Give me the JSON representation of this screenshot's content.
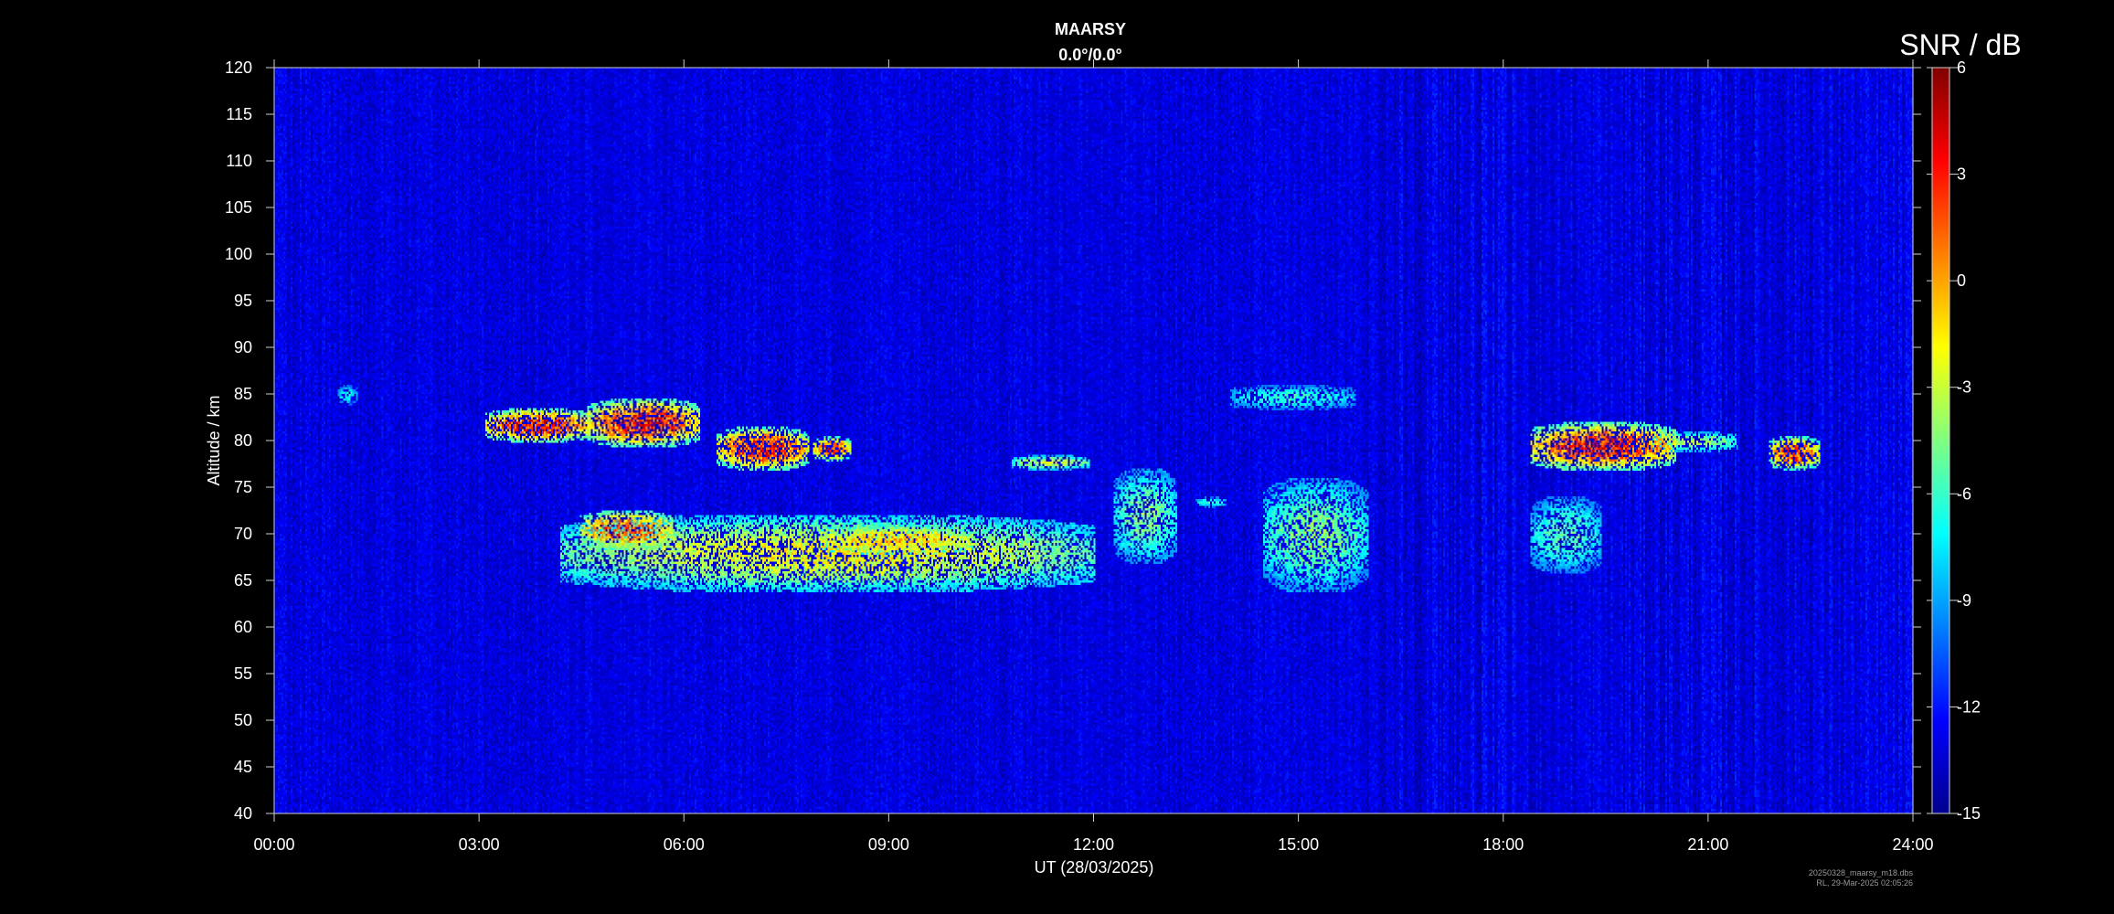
{
  "chart_data": {
    "type": "heatmap",
    "title": "MAARSY",
    "subtitle": "0.0°/0.0°",
    "xlabel": "UT (28/03/2025)",
    "ylabel": "Altitude / km",
    "xlim": [
      0,
      24
    ],
    "ylim": [
      40,
      120
    ],
    "x_ticks": [
      "00:00",
      "03:00",
      "06:00",
      "09:00",
      "12:00",
      "15:00",
      "18:00",
      "21:00",
      "24:00"
    ],
    "x_tick_values": [
      0,
      3,
      6,
      9,
      12,
      15,
      18,
      21,
      24
    ],
    "y_ticks": [
      40,
      45,
      50,
      55,
      60,
      65,
      70,
      75,
      80,
      85,
      90,
      95,
      100,
      105,
      110,
      115,
      120
    ],
    "colorbar": {
      "label": "SNR / dB",
      "range": [
        -15,
        6
      ],
      "ticks": [
        6,
        3,
        0,
        -3,
        -6,
        -9,
        -12,
        -15
      ],
      "colormap": "jet"
    },
    "background_snr": -13,
    "echo_regions": [
      {
        "t_start": 3.1,
        "t_end": 4.6,
        "alt_low": 80,
        "alt_high": 83.5,
        "peak_snr": 6
      },
      {
        "t_start": 4.6,
        "t_end": 6.2,
        "alt_low": 79.5,
        "alt_high": 84.5,
        "peak_snr": 6
      },
      {
        "t_start": 6.5,
        "t_end": 7.8,
        "alt_low": 77,
        "alt_high": 81.5,
        "peak_snr": 6
      },
      {
        "t_start": 7.9,
        "t_end": 8.4,
        "alt_low": 78,
        "alt_high": 80.5,
        "peak_snr": 5
      },
      {
        "t_start": 4.5,
        "t_end": 5.8,
        "alt_low": 68.5,
        "alt_high": 72.5,
        "peak_snr": 5
      },
      {
        "t_start": 4.2,
        "t_end": 12.0,
        "alt_low": 64,
        "alt_high": 72,
        "peak_snr": 0
      },
      {
        "t_start": 8.0,
        "t_end": 10.2,
        "alt_low": 68,
        "alt_high": 71,
        "peak_snr": 2
      },
      {
        "t_start": 10.8,
        "t_end": 11.9,
        "alt_low": 77,
        "alt_high": 78.5,
        "peak_snr": -1
      },
      {
        "t_start": 12.3,
        "t_end": 13.2,
        "alt_low": 67,
        "alt_high": 77,
        "peak_snr": -3
      },
      {
        "t_start": 13.5,
        "t_end": 13.9,
        "alt_low": 73,
        "alt_high": 74,
        "peak_snr": -5
      },
      {
        "t_start": 14.0,
        "t_end": 15.8,
        "alt_low": 83.5,
        "alt_high": 86,
        "peak_snr": -5
      },
      {
        "t_start": 14.5,
        "t_end": 16.0,
        "alt_low": 64,
        "alt_high": 76,
        "peak_snr": -3
      },
      {
        "t_start": 18.4,
        "t_end": 20.5,
        "alt_low": 77,
        "alt_high": 82,
        "peak_snr": 6
      },
      {
        "t_start": 18.4,
        "t_end": 19.4,
        "alt_low": 66,
        "alt_high": 74,
        "peak_snr": -4
      },
      {
        "t_start": 20.2,
        "t_end": 21.4,
        "alt_low": 79,
        "alt_high": 81,
        "peak_snr": -2
      },
      {
        "t_start": 21.9,
        "t_end": 22.6,
        "alt_low": 77,
        "alt_high": 80.5,
        "peak_snr": 5
      },
      {
        "t_start": 0.95,
        "t_end": 1.2,
        "alt_low": 84,
        "alt_high": 86,
        "peak_snr": -6
      }
    ],
    "footer": [
      "20250328_maarsy_m18.dbs",
      "RL, 29-Mar-2025 02:05:26"
    ]
  }
}
